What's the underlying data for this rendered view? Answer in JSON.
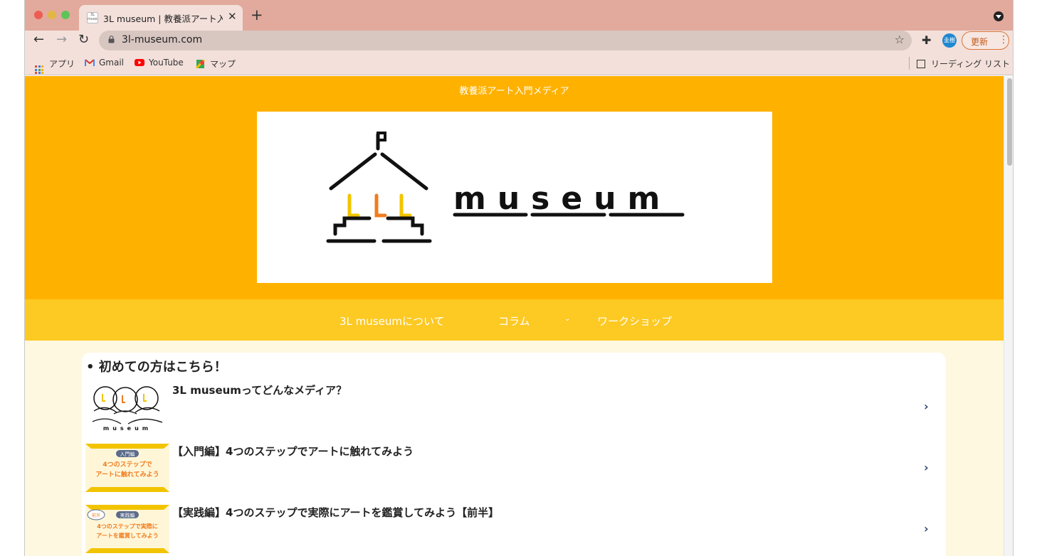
{
  "browser": {
    "tab_title": "3L museum | 教養派アート入門メ",
    "tab_favicon_text": "3L museum",
    "url": "3l-museum.com",
    "avatar_text": "圭樹",
    "update_label": "更新",
    "bookmarks": [
      {
        "label": "アプリ",
        "icon": "apps-grid-icon"
      },
      {
        "label": "Gmail",
        "icon": "gmail-icon"
      },
      {
        "label": "YouTube",
        "icon": "youtube-icon"
      },
      {
        "label": "マップ",
        "icon": "maps-icon"
      }
    ],
    "reading_list": "リーディング リスト"
  },
  "site": {
    "tagline": "教養派アート入門メディア",
    "logo_text": "museum",
    "nav": [
      {
        "label": "3L museumについて"
      },
      {
        "label": "コラム",
        "has_dropdown": true
      },
      {
        "label": "ワークショップ"
      }
    ],
    "section_heading": "• 初めての方はこちら！",
    "articles": [
      {
        "title": "3L museumってどんなメディア？",
        "thumb_text": "museum"
      },
      {
        "title": "【入門編】4つのステップでアートに触れてみよう",
        "thumb_label": "入門編",
        "thumb_lines": [
          "4つのステップで",
          "アートに触れてみよう"
        ]
      },
      {
        "title": "【実践編】4つのステップで実際にアートを鑑賞してみよう【前半】",
        "thumb_label": "実践編",
        "thumb_badge": "前半",
        "thumb_lines": [
          "4つのステップで実際に",
          "アートを鑑賞してみよう"
        ]
      }
    ]
  },
  "colors": {
    "hero": "#ffb100",
    "navbar": "#fdc923",
    "page_bg": "#fff8e1",
    "accent_orange": "#f07c1f",
    "accent_yellow": "#f2c400"
  }
}
